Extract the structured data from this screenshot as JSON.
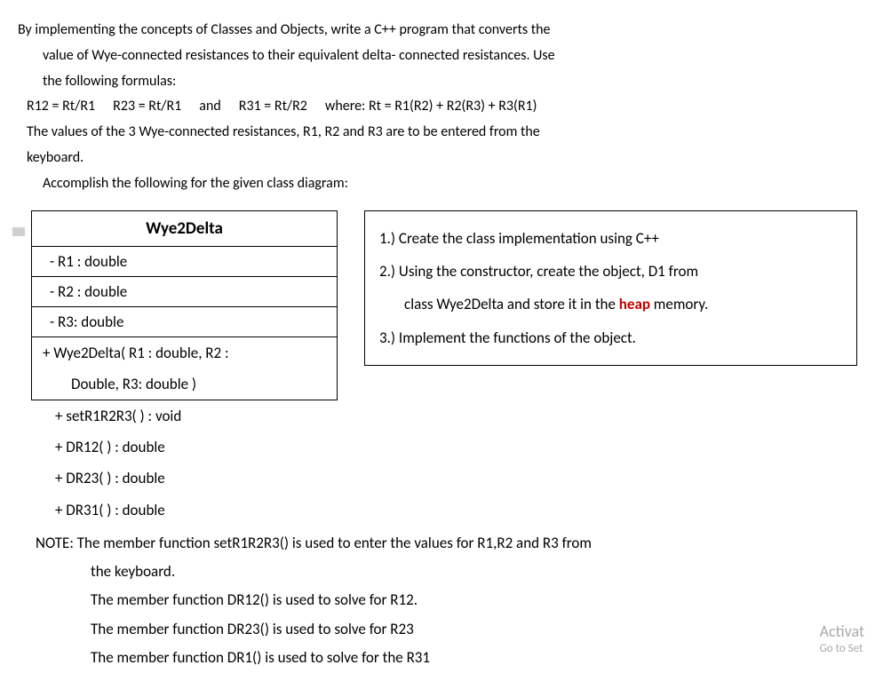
{
  "intro": {
    "line1": "By implementing the concepts of Classes and Objects, write a C++ program that converts the",
    "line2": "value of Wye-connected resistances to their equivalent delta- connected resistances. Use",
    "line3": "the following formulas:",
    "formula_r12": "R12 = Rt/R1",
    "formula_r23": "R23 =  Rt/R1",
    "formula_and": "and",
    "formula_r31": "R31 = Rt/R2",
    "formula_where": "where: Rt = R1(R2) + R2(R3) + R3(R1)",
    "line5": "The values of the 3 Wye-connected resistances, R1, R2 and R3 are to be entered from the",
    "line6": "keyboard.",
    "line7": "Accomplish the following for the given class diagram:"
  },
  "class_diagram": {
    "name": "Wye2Delta",
    "attrs": [
      "-     R1 : double",
      "-     R2 : double",
      "-     R3:  double"
    ],
    "methods": [
      "+   Wye2Delta( R1 : double, R2 :",
      "Double, R3: double )",
      "+   setR1R2R3( ) :  void",
      "+   DR12( ) : double",
      "+   DR23( ) :  double",
      "+   DR31( ) :  double"
    ]
  },
  "tasks": {
    "t1": "1.) Create the class implementation using C++",
    "t2": "2.) Using the constructor, create the object, D1 from",
    "t2b_pre": "class Wye2Delta and store it in the ",
    "t2b_heap": "heap",
    "t2b_post": " memory.",
    "t3": "3.) Implement the functions of the  object."
  },
  "note": {
    "n1": "NOTE: The member function setR1R2R3() is used to enter the values for R1,R2 and R3  from",
    "n1b": "the keyboard.",
    "n2": "The member function DR12() is used to solve for R12.",
    "n3": "The member function DR23() is used to solve for R23",
    "n4": "The member function  DR1() is used to solve for the  R31"
  },
  "watermark": {
    "main": "Activat",
    "sub": "Go to Set"
  }
}
